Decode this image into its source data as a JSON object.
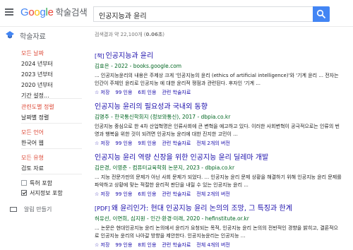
{
  "header": {
    "logo_letters": [
      "G",
      "o",
      "o",
      "g",
      "l",
      "e"
    ],
    "logo_suffix": "학술검색",
    "search_value": "인공지능과 윤리",
    "colors": {
      "blue": "#4285f4",
      "red": "#ea4335",
      "yellow": "#fbbc05",
      "green": "#34a853"
    }
  },
  "scholar_label": "학술자료",
  "stats": {
    "prefix": "검색결과 약 22,100개 (",
    "time": "0.06초",
    "suffix": ")"
  },
  "sidebar": {
    "date": {
      "title": "모든 날짜",
      "items": [
        "2024 년부터",
        "2023 년부터",
        "2020 년부터",
        "기간 설정..."
      ]
    },
    "sort": {
      "title": "관련도별 정렬",
      "items": [
        "날짜별 정렬"
      ]
    },
    "lang": {
      "title": "모든 언어",
      "items": [
        "한국어 웹"
      ]
    },
    "type": {
      "title": "모든 유형",
      "items": [
        "검토 자료"
      ]
    },
    "checks": [
      {
        "label": "특허 포함",
        "checked": false
      },
      {
        "label": "서지정보 포함",
        "checked": true
      }
    ],
    "alert": "알림 만들기"
  },
  "results": [
    {
      "tag": "[책]",
      "title": "인공지능과 윤리",
      "meta": "김효은 - 2022 - books.google.com",
      "snippet": "... 인공지능윤리의 내용은 주제상 크게 '인공지능의 윤리 (ethics of artificial intelligence)'와 '기계 윤리 ... 전자는 인간이 주체인 윤리로 인공지능 에 대한 윤리적 쟁점과 관련된다. 후자인 '기계 ...",
      "actions": [
        "☆ 저장",
        "99 인용",
        "6회 인용",
        "관련 학술자료"
      ]
    },
    {
      "tag": "",
      "title": "인공지능 윤리의 필요성과 국내외 동향",
      "meta": "김명주 - 한국통신학회지 (정보와통신), 2017 - dbpia.co.kr",
      "snippet": "인공지능 중심으로 한 4차 산업혁명은 인류사회에 큰 변혁을 예고하고 있다. 이러한 사회변혁이 공극적으로는 인류의 번영과 행복을 위한 것이 되려면 인공지능 윤리에 대한 진지한 고민이 ...",
      "actions": [
        "☆ 저장",
        "99 인용",
        "9회 인용",
        "관련 학술자료",
        "전체 2개의 버전"
      ]
    },
    {
      "tag": "",
      "title": "인공지능 윤리 역량 신장을 위한 인공지능 윤리 딜레마 개발",
      "meta": "김은경, 이영준 - 컴퓨터교육학회 논문지, 2023 - dbpia.co.kr",
      "snippet": "... 지능 전문가만의 문제가 아닌 사회 문제가 되었다. ... 인공지능 윤리 문제 상황을 해결하기 위해 인공지능 윤리 문제를 파악하고 상황에 맞는 적절한 윤리적 판단을 내릴 수 있는 인공지능 윤리 ...",
      "actions": [
        "☆ 저장",
        "99 인용",
        "6회 인용",
        "관련 학술자료",
        "전체 2개의 버전"
      ]
    },
    {
      "tag": "[PDF]",
      "title": "왜 윤리인가: 현대 인공지능 윤리 논의의 조망, 그 특징과 한계",
      "meta": "허유선, 이연희, 심지원 - 인간·환경·미래, 2020 - hefinstitute.or.kr",
      "snippet": "... 논문은 현대인공지능 윤리 논의에서 윤리가 요청되는 목적, 인공지능 윤리 논의의 전반적인 경향을 밝히고, 결론적으로 인공지능 윤리의 나아갈 방향을 제안한다. 인공지능윤리는 인공지능 ...",
      "actions": [
        "☆ 저장",
        "99 인용",
        "8회 인용",
        "관련 학술자료",
        "전체 4개의 버전"
      ]
    }
  ]
}
